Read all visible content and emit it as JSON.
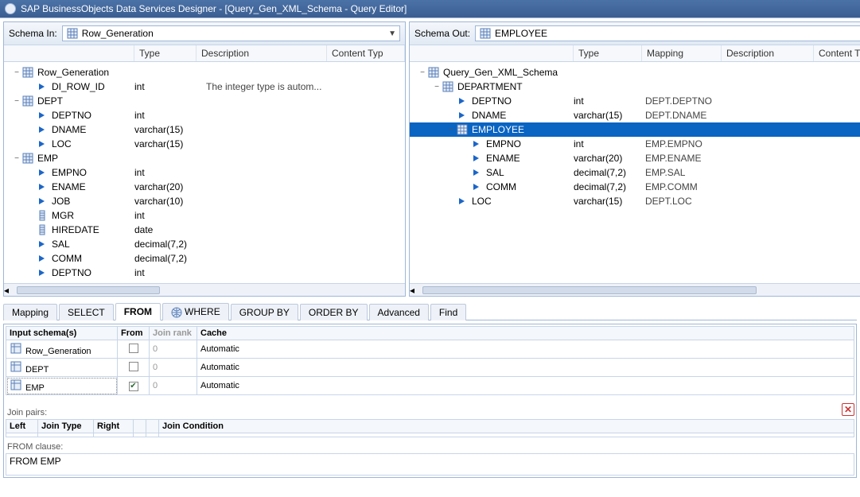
{
  "titlebar": {
    "text": "SAP BusinessObjects Data Services Designer - [Query_Gen_XML_Schema - Query Editor]"
  },
  "schemaIn": {
    "label": "Schema In:",
    "selected": "Row_Generation",
    "headers": {
      "type": "Type",
      "desc": "Description",
      "content": "Content Typ"
    }
  },
  "schemaOut": {
    "label": "Schema Out:",
    "selected": "EMPLOYEE",
    "headers": {
      "type": "Type",
      "mapping": "Mapping",
      "desc": "Description",
      "content": "Content Type"
    }
  },
  "inTree": [
    {
      "indent": 0,
      "tog": "−",
      "icon": "grid",
      "name": "Row_Generation"
    },
    {
      "indent": 1,
      "tog": "",
      "icon": "arrow",
      "name": "DI_ROW_ID",
      "type": "int",
      "desc": "The integer type is autom..."
    },
    {
      "indent": 0,
      "tog": "−",
      "icon": "grid",
      "name": "DEPT"
    },
    {
      "indent": 1,
      "tog": "",
      "icon": "arrow",
      "name": "DEPTNO",
      "type": "int"
    },
    {
      "indent": 1,
      "tog": "",
      "icon": "arrow",
      "name": "DNAME",
      "type": "varchar(15)"
    },
    {
      "indent": 1,
      "tog": "",
      "icon": "arrow",
      "name": "LOC",
      "type": "varchar(15)"
    },
    {
      "indent": 0,
      "tog": "−",
      "icon": "grid",
      "name": "EMP"
    },
    {
      "indent": 1,
      "tog": "",
      "icon": "arrow",
      "name": "EMPNO",
      "type": "int"
    },
    {
      "indent": 1,
      "tog": "",
      "icon": "arrow",
      "name": "ENAME",
      "type": "varchar(20)"
    },
    {
      "indent": 1,
      "tog": "",
      "icon": "arrow",
      "name": "JOB",
      "type": "varchar(10)"
    },
    {
      "indent": 1,
      "tog": "",
      "icon": "col",
      "name": "MGR",
      "type": "int"
    },
    {
      "indent": 1,
      "tog": "",
      "icon": "col",
      "name": "HIREDATE",
      "type": "date"
    },
    {
      "indent": 1,
      "tog": "",
      "icon": "arrow",
      "name": "SAL",
      "type": "decimal(7,2)"
    },
    {
      "indent": 1,
      "tog": "",
      "icon": "arrow",
      "name": "COMM",
      "type": "decimal(7,2)"
    },
    {
      "indent": 1,
      "tog": "",
      "icon": "arrow",
      "name": "DEPTNO",
      "type": "int"
    }
  ],
  "outTree": [
    {
      "indent": 0,
      "tog": "−",
      "icon": "grid",
      "name": "Query_Gen_XML_Schema"
    },
    {
      "indent": 1,
      "tog": "−",
      "icon": "grid",
      "name": "DEPARTMENT"
    },
    {
      "indent": 2,
      "tog": "",
      "icon": "arrow",
      "name": "DEPTNO",
      "type": "int",
      "mapping": "DEPT.DEPTNO"
    },
    {
      "indent": 2,
      "tog": "",
      "icon": "arrow",
      "name": "DNAME",
      "type": "varchar(15)",
      "mapping": "DEPT.DNAME"
    },
    {
      "indent": 2,
      "tog": "−",
      "icon": "grid",
      "name": "EMPLOYEE",
      "selected": true
    },
    {
      "indent": 3,
      "tog": "",
      "icon": "arrow",
      "name": "EMPNO",
      "type": "int",
      "mapping": "EMP.EMPNO"
    },
    {
      "indent": 3,
      "tog": "",
      "icon": "arrow",
      "name": "ENAME",
      "type": "varchar(20)",
      "mapping": "EMP.ENAME"
    },
    {
      "indent": 3,
      "tog": "",
      "icon": "arrow",
      "name": "SAL",
      "type": "decimal(7,2)",
      "mapping": "EMP.SAL"
    },
    {
      "indent": 3,
      "tog": "",
      "icon": "arrow",
      "name": "COMM",
      "type": "decimal(7,2)",
      "mapping": "EMP.COMM"
    },
    {
      "indent": 2,
      "tog": "",
      "icon": "arrow",
      "name": "LOC",
      "type": "varchar(15)",
      "mapping": "DEPT.LOC"
    }
  ],
  "tabs": {
    "mapping": "Mapping",
    "select": "SELECT",
    "from": "FROM",
    "where": "WHERE",
    "groupby": "GROUP BY",
    "orderby": "ORDER BY",
    "advanced": "Advanced",
    "find": "Find"
  },
  "fromGrid": {
    "headers": {
      "schema": "Input schema(s)",
      "from": "From",
      "rank": "Join rank",
      "cache": "Cache"
    },
    "rows": [
      {
        "schema": "Row_Generation",
        "from": false,
        "rank": "0",
        "cache": "Automatic"
      },
      {
        "schema": "DEPT",
        "from": false,
        "rank": "0",
        "cache": "Automatic"
      },
      {
        "schema": "EMP",
        "from": true,
        "rank": "0",
        "cache": "Automatic",
        "dotted": true
      }
    ]
  },
  "joinSection": {
    "label": "Join pairs:",
    "headers": {
      "left": "Left",
      "type": "Join Type",
      "right": "Right",
      "cond": "Join Condition"
    }
  },
  "fromClause": {
    "label": "FROM clause:",
    "text": "FROM  EMP"
  }
}
